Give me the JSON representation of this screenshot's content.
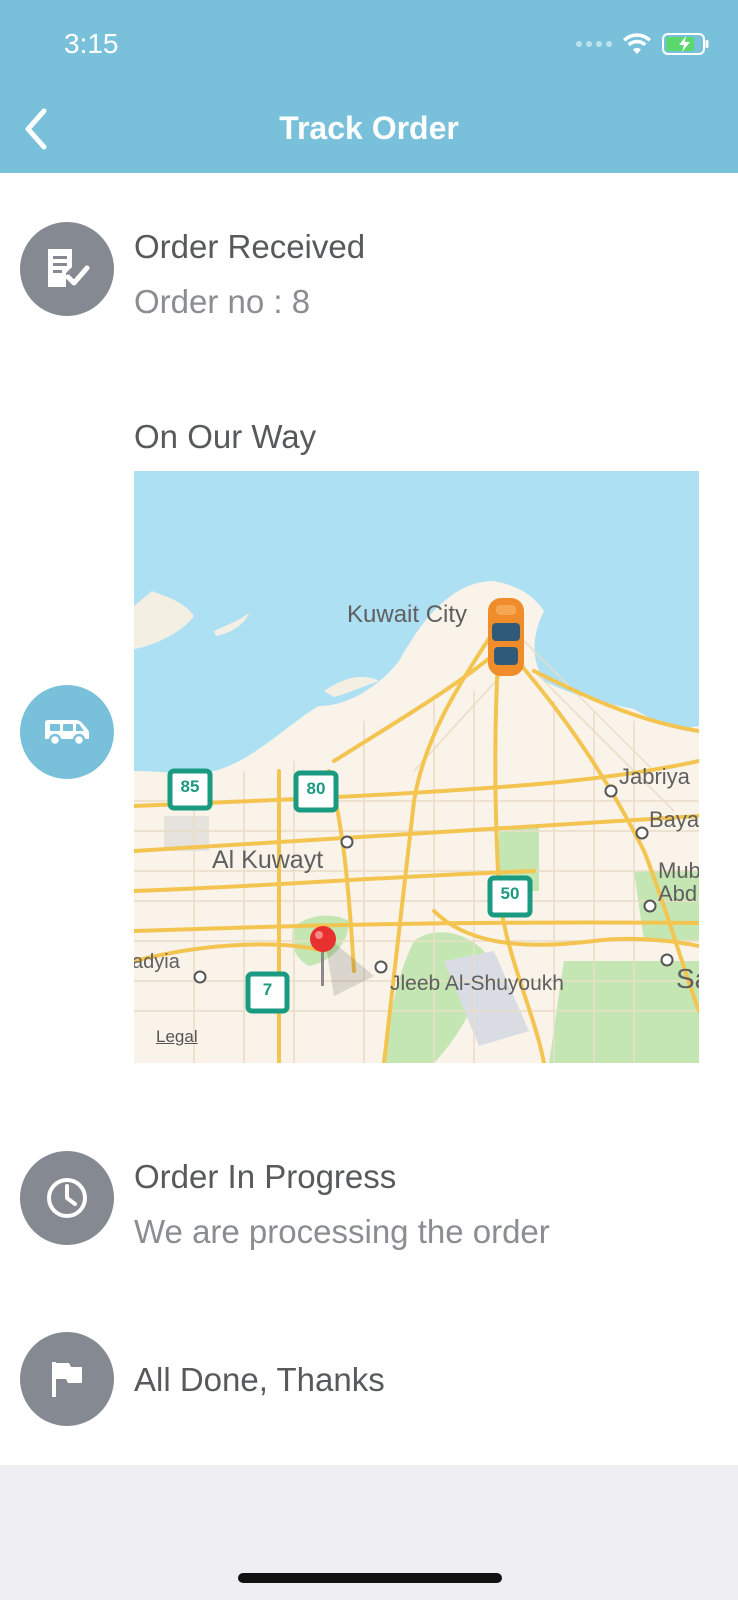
{
  "status_bar": {
    "time": "3:15"
  },
  "header": {
    "title": "Track Order"
  },
  "steps": [
    {
      "title": "Order Received",
      "subtitle": "Order no : 8",
      "icon": "order-list-check-icon"
    },
    {
      "title": "On Our Way",
      "icon": "delivery-van-icon"
    },
    {
      "title": "Order In Progress",
      "subtitle": "We are processing the order",
      "icon": "clock-icon"
    },
    {
      "title": "All Done, Thanks",
      "icon": "flag-icon"
    }
  ],
  "map": {
    "labels": {
      "kuwait_city": "Kuwait City",
      "al_kuwayt": "Al Kuwayt",
      "jabriya": "Jabriya",
      "bayan": "Bayan",
      "mub": "Mub",
      "abd": "Abd",
      "jleeb": "Jleeb Al-Shuyoukh",
      "hadyia": "adyia",
      "sa": "Sa"
    },
    "route_shields": [
      "85",
      "80",
      "50",
      "7"
    ],
    "legal": "Legal"
  },
  "colors": {
    "header": "#79c1da",
    "active_step": "#79c1da",
    "inactive_step": "#858991",
    "water": "#aee0f4",
    "road": "#f3c550",
    "shield": "#1a9a80",
    "pin": "#e8302f",
    "car": "#f08c2a"
  }
}
